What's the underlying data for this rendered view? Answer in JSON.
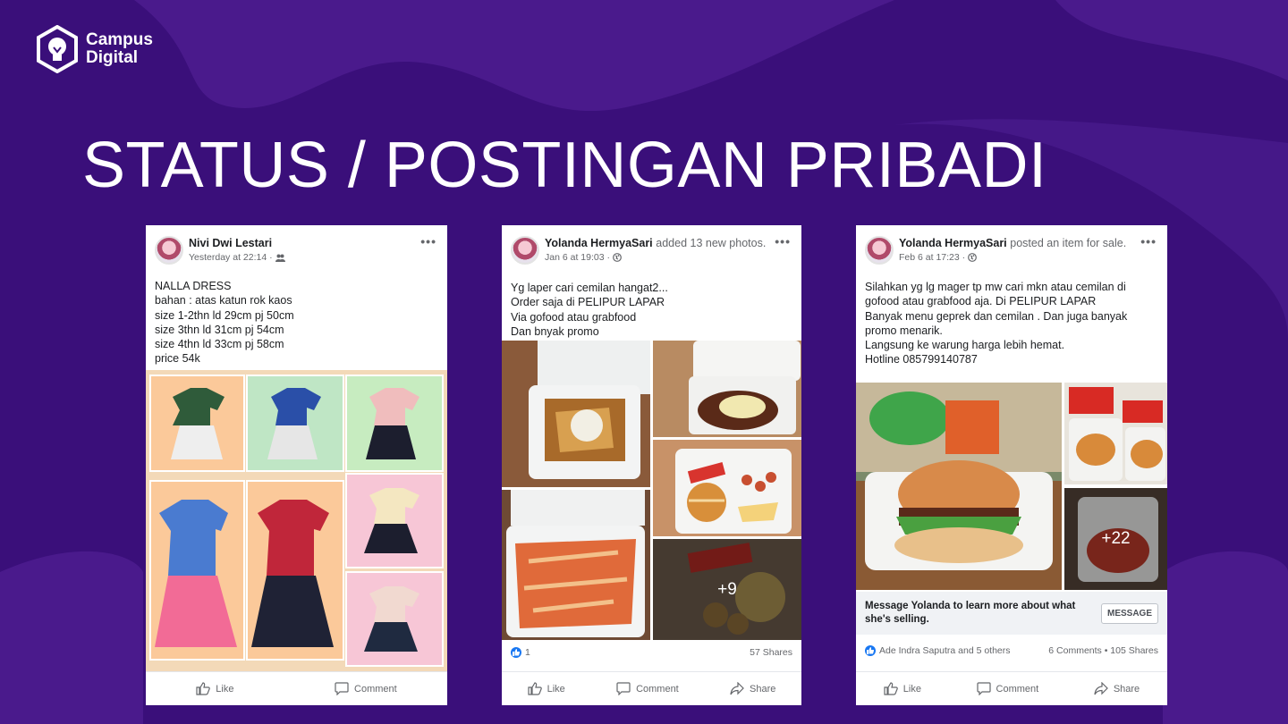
{
  "colors": {
    "background": "#3a0f7a",
    "blob": "#4a1a8c",
    "facebook_blue": "#1877f2"
  },
  "logo": {
    "line1": "Campus",
    "line2": "Digital",
    "icon": "lightbulb-hexagon-icon"
  },
  "title": "STATUS / POSTINGAN PRIBADI",
  "posts": [
    {
      "author": "Nivi Dwi Lestari",
      "action": "",
      "time": "Yesterday at 22:14 ·",
      "audience_icon": "friends-icon",
      "lines": [
        "NALLA DRESS",
        "bahan : atas katun rok kaos",
        "size 1-2thn ld 29cm pj 50cm",
        "size 3thn ld 31cm pj 54cm",
        "size 4thn ld 33cm pj 58cm",
        "price 54k"
      ],
      "actions": [
        "Like",
        "Comment"
      ]
    },
    {
      "author": "Yolanda HermyaSari",
      "action": "added 13 new photos.",
      "time": "Jan 6 at 19:03 ·",
      "audience_icon": "globe-icon",
      "lines": [
        "Yg laper cari cemilan hangat2...",
        "Order saja di PELIPUR LAPAR",
        "Via gofood atau grabfood",
        "Dan bnyak promo"
      ],
      "more_photos": "+9",
      "reactions": "1",
      "shares": "57 Shares",
      "actions": [
        "Like",
        "Comment",
        "Share"
      ]
    },
    {
      "author": "Yolanda HermyaSari",
      "action": "posted an item for sale.",
      "time": "Feb 6 at 17:23 ·",
      "audience_icon": "globe-icon",
      "lines": [
        "Silahkan yg lg mager tp mw cari mkn atau cemilan di",
        "gofood atau grabfood aja. Di PELIPUR LAPAR",
        "Banyak menu geprek dan cemilan . Dan juga banyak",
        "promo menarik.",
        "Langsung ke warung harga lebih hemat.",
        "Hotline 085799140787"
      ],
      "more_photos": "+22",
      "message_prompt": "Message Yolanda to learn more about what she's selling.",
      "message_button": "MESSAGE",
      "reactions": "Ade Indra Saputra and 5 others",
      "counts": "6 Comments • 105 Shares",
      "actions": [
        "Like",
        "Comment",
        "Share"
      ]
    }
  ]
}
